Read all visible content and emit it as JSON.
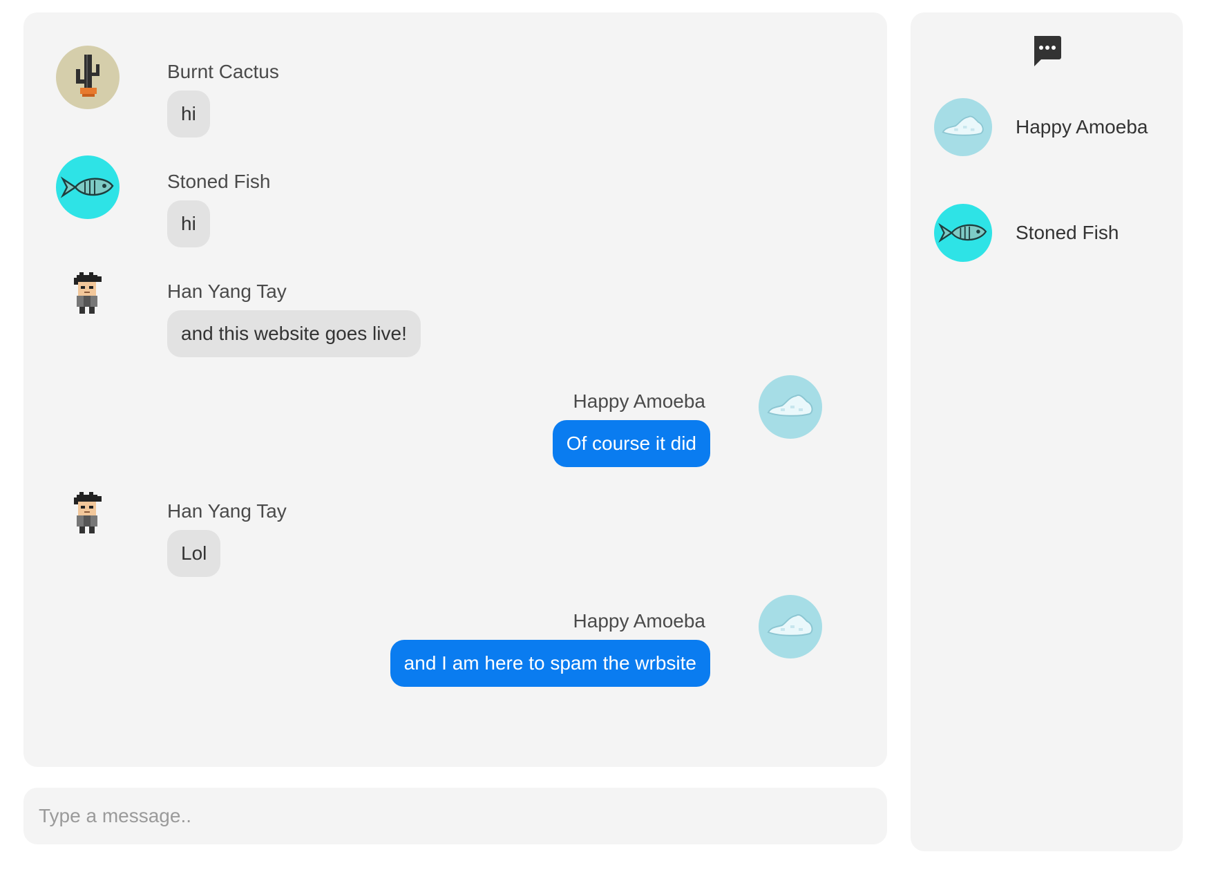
{
  "colors": {
    "panel_bg": "#f4f4f4",
    "incoming_bubble": "#e2e2e2",
    "outgoing_bubble": "#0a7cf0",
    "outgoing_text": "#ffffff",
    "cactus_avatar_bg": "#d5ceab",
    "fish_avatar_bg": "#2ee3e6",
    "amoeba_avatar_bg": "#a6dde6"
  },
  "messages": [
    {
      "sender": "Burnt Cactus",
      "text": "hi",
      "direction": "incoming",
      "avatar_icon": "cactus-icon"
    },
    {
      "sender": "Stoned Fish",
      "text": "hi",
      "direction": "incoming",
      "avatar_icon": "fish-icon"
    },
    {
      "sender": "Han Yang Tay",
      "text": "and this website goes live!",
      "direction": "incoming",
      "avatar_icon": "pixel-person-icon"
    },
    {
      "sender": "Happy Amoeba",
      "text": "Of course it did",
      "direction": "outgoing",
      "avatar_icon": "cloud-blob-icon"
    },
    {
      "sender": "Han Yang Tay",
      "text": "Lol",
      "direction": "incoming",
      "avatar_icon": "pixel-person-icon"
    },
    {
      "sender": "Happy Amoeba",
      "text": "and I am here to spam the wrbsite",
      "direction": "outgoing",
      "avatar_icon": "cloud-blob-icon"
    }
  ],
  "input": {
    "placeholder": "Type a message..",
    "value": ""
  },
  "sidebar": {
    "toggle_icon": "chat-bubble-icon",
    "users": [
      {
        "name": "Happy Amoeba",
        "avatar_icon": "cloud-blob-icon"
      },
      {
        "name": "Stoned Fish",
        "avatar_icon": "fish-icon"
      }
    ]
  }
}
